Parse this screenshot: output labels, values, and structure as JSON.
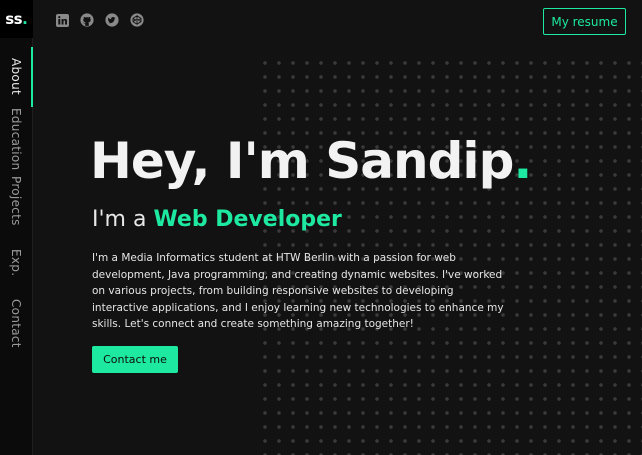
{
  "logo": {
    "text": "ss",
    "dot": "."
  },
  "nav": {
    "items": [
      {
        "label": "About",
        "active": true
      },
      {
        "label": "Education",
        "active": false
      },
      {
        "label": "Projects",
        "active": false
      },
      {
        "label": "Exp.",
        "active": false
      },
      {
        "label": "Contact",
        "active": false
      }
    ]
  },
  "social": [
    {
      "icon": "linkedin-icon"
    },
    {
      "icon": "github-icon"
    },
    {
      "icon": "twitter-icon"
    },
    {
      "icon": "codepen-icon"
    }
  ],
  "header": {
    "resume_label": "My resume"
  },
  "hero": {
    "title": "Hey, I'm Sandip",
    "title_dot": ".",
    "subtitle_prefix": "I'm a ",
    "role": "Web Developer",
    "bio": "I'm a Media Informatics student at HTW Berlin with a passion for web development, Java programming, and creating dynamic websites. I've worked on various projects, from building responsive websites to developing interactive applications, and I enjoy learning new technologies to enhance my skills. Let's connect and create something amazing together!",
    "contact_label": "Contact me"
  },
  "colors": {
    "accent": "#1de9a0",
    "background": "#121212",
    "sidebar": "#0b0b0b"
  }
}
